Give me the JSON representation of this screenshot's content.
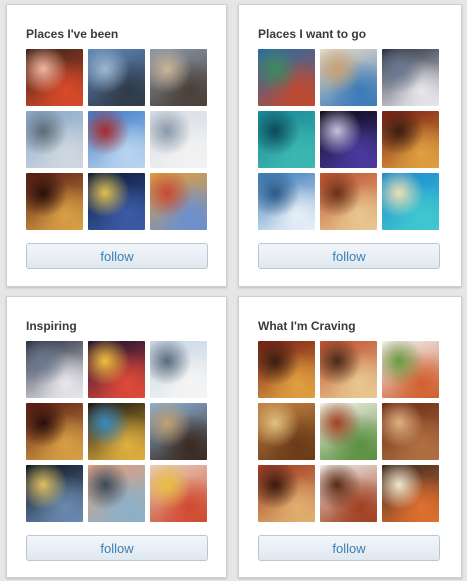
{
  "boards": [
    {
      "title": "Places I've been",
      "follow_label": "follow",
      "thumbnails": [
        {
          "subject": "sushi",
          "colors": [
            "#3a2318",
            "#d94a2a",
            "#f2b6a0"
          ]
        },
        {
          "subject": "skyscraper",
          "colors": [
            "#5b86b8",
            "#2f3a48",
            "#9fb7cf"
          ]
        },
        {
          "subject": "city-street",
          "colors": [
            "#8a96a8",
            "#4a4038",
            "#c9b59a"
          ]
        },
        {
          "subject": "city-skyline",
          "colors": [
            "#89a7c9",
            "#cfd8df",
            "#5d6b75"
          ]
        },
        {
          "subject": "glass-tower",
          "colors": [
            "#3f7ac8",
            "#b9d6f0",
            "#a82a2a"
          ]
        },
        {
          "subject": "sydney-opera-house",
          "colors": [
            "#d7dde5",
            "#f2f2f2",
            "#8a98a8"
          ]
        },
        {
          "subject": "opera-interior",
          "colors": [
            "#5a1c14",
            "#d9a045",
            "#2a0e0a"
          ]
        },
        {
          "subject": "night-harbor",
          "colors": [
            "#0c1c3a",
            "#3c5aa8",
            "#e0c050"
          ]
        },
        {
          "subject": "mosaic-park",
          "colors": [
            "#e0a040",
            "#6a8fd0",
            "#c84830"
          ]
        }
      ]
    },
    {
      "title": "Places I want to go",
      "follow_label": "follow",
      "thumbnails": [
        {
          "subject": "coastline-aerial",
          "colors": [
            "#2a6aa8",
            "#c04a30",
            "#3c8a60"
          ]
        },
        {
          "subject": "harbor-town",
          "colors": [
            "#e8dcc8",
            "#3a7ab8",
            "#c8a070"
          ]
        },
        {
          "subject": "observatory",
          "colors": [
            "#2a3040",
            "#e8e8ec",
            "#6a7890"
          ]
        },
        {
          "subject": "lagoon",
          "colors": [
            "#1c8a98",
            "#3cb8b0",
            "#0c4a58"
          ]
        },
        {
          "subject": "concert-crowd",
          "colors": [
            "#0a0a14",
            "#4a3aa0",
            "#c8c0e0"
          ]
        },
        {
          "subject": "bottles-food",
          "colors": [
            "#7a1e14",
            "#e0a040",
            "#3a1e10"
          ]
        },
        {
          "subject": "ocean-waves",
          "colors": [
            "#3a7ab8",
            "#e8f0f8",
            "#2a5a88"
          ]
        },
        {
          "subject": "street-food",
          "colors": [
            "#c05030",
            "#e8c890",
            "#6a3018"
          ]
        },
        {
          "subject": "tropical-beach",
          "colors": [
            "#1a8ad0",
            "#40c8d0",
            "#f0e0b0"
          ]
        }
      ]
    },
    {
      "title": "Inspiring",
      "follow_label": "follow",
      "thumbnails": [
        {
          "subject": "observatory",
          "colors": [
            "#2a3040",
            "#e8e8ec",
            "#6a7890"
          ]
        },
        {
          "subject": "times-square",
          "colors": [
            "#1a1030",
            "#e04a3a",
            "#f0c040"
          ]
        },
        {
          "subject": "sydney-opera-house",
          "colors": [
            "#c8d6e6",
            "#f5f5f5",
            "#5a6a7a"
          ]
        },
        {
          "subject": "opera-interior",
          "colors": [
            "#5a1c14",
            "#d9a045",
            "#2a0e0a"
          ]
        },
        {
          "subject": "night-pool",
          "colors": [
            "#1a140c",
            "#e0b040",
            "#3a8ac0"
          ]
        },
        {
          "subject": "temple",
          "colors": [
            "#8ab0d8",
            "#3a2a20",
            "#c0a070"
          ]
        },
        {
          "subject": "night-bridge",
          "colors": [
            "#0a1420",
            "#6a8ab0",
            "#e0c060"
          ]
        },
        {
          "subject": "pier-sunset",
          "colors": [
            "#e0a080",
            "#8ab0c8",
            "#3a4a58"
          ]
        },
        {
          "subject": "flower-mosaic",
          "colors": [
            "#e8d0c0",
            "#d04a30",
            "#e8c040"
          ]
        }
      ]
    },
    {
      "title": "What I'm Craving",
      "follow_label": "follow",
      "thumbnails": [
        {
          "subject": "bottles-food",
          "colors": [
            "#7a1e14",
            "#e0a040",
            "#3a1e10"
          ]
        },
        {
          "subject": "skewers",
          "colors": [
            "#c05030",
            "#e8c890",
            "#4a2a18"
          ]
        },
        {
          "subject": "plated-dish",
          "colors": [
            "#f2f2f2",
            "#d06030",
            "#6a9a40"
          ]
        },
        {
          "subject": "platters",
          "colors": [
            "#c08040",
            "#6a3a18",
            "#e0c080"
          ]
        },
        {
          "subject": "garnished-plate",
          "colors": [
            "#f4f0ea",
            "#5a9040",
            "#a04020"
          ]
        },
        {
          "subject": "grilled-meat",
          "colors": [
            "#6a2a14",
            "#b07040",
            "#e0b080"
          ]
        },
        {
          "subject": "deli-counter",
          "colors": [
            "#a03a20",
            "#e0b070",
            "#3a1a10"
          ]
        },
        {
          "subject": "skewered-meat",
          "colors": [
            "#f0ece8",
            "#a04020",
            "#5a2a14"
          ]
        },
        {
          "subject": "sushi-rolls",
          "colors": [
            "#3a2a20",
            "#e07030",
            "#f0e8d0"
          ]
        }
      ]
    }
  ]
}
